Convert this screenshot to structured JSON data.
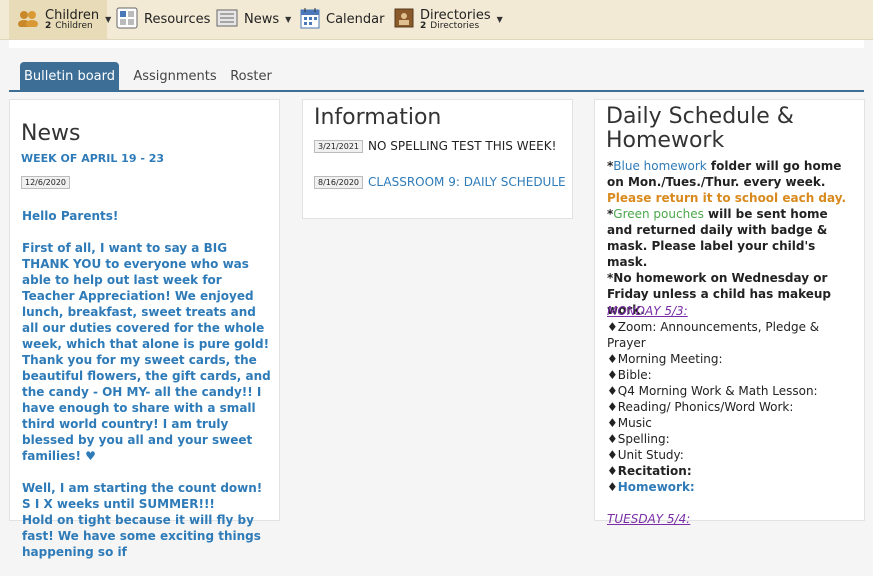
{
  "topnav": {
    "children_label": "Children",
    "children_count": "2",
    "children_sub": "Children",
    "resources": "Resources",
    "news": "News",
    "calendar": "Calendar",
    "directories_label": "Directories",
    "directories_count": "2",
    "directories_sub": "Directories"
  },
  "tabs": [
    "Bulletin board",
    "Assignments",
    "Roster"
  ],
  "news_card": {
    "title": "News",
    "week": "WEEK OF APRIL 19 - 23",
    "date": "12/6/2020",
    "greeting": "Hello Parents!",
    "p1": "First of all, I want to say a BIG THANK YOU  to everyone who was able to help out last week for Teacher Appreciation!  We enjoyed lunch, breakfast, sweet treats and all our duties covered for the whole week, which that alone is pure gold! Thank you for my sweet cards, the beautiful flowers, the gift cards, and the candy - OH MY- all the candy!! I have enough to share with a small third world country!  I am truly blessed by you all and your sweet families! ♥",
    "p2": "Well, I am starting the count down!  S I X weeks until SUMMER!!!",
    "p3": "Hold on tight because it will fly by fast!  We have some exciting things happening so if"
  },
  "info_card": {
    "title": "Information",
    "item1_date": "3/21/2021",
    "item1_text": "NO SPELLING TEST THIS WEEK!",
    "item2_date": "8/16/2020",
    "item2_text": "CLASSROOM 9: DAILY SCHEDULE"
  },
  "schedule_card": {
    "title_line1": "Daily Schedule &",
    "title_line2": "Homework",
    "blue_prefix": "*",
    "blue_hw": "Blue homework",
    "blue_rest": " folder will go home on Mon./Tues./Thur. every week.",
    "orange_text": "  Please return it to school each day.",
    "green_prefix": "*",
    "green_text": "Green pouches",
    "green_rest": " will be sent home and returned daily with badge & mask. Please label your child's mask.",
    "no_hw": "*No homework on Wednesday or Friday unless a child has makeup work.",
    "monday": "MONDAY 5/3: ",
    "items": [
      "♦Zoom: Announcements, Pledge & Prayer",
      "♦Morning Meeting:",
      "♦Bible:",
      "♦Q4 Morning Work & Math Lesson:",
      "♦Reading/ Phonics/Word Work:",
      "♦Music",
      "♦Spelling:",
      "♦Unit Study:"
    ],
    "recitation": "♦Recitation:",
    "homework_prefix": "♦",
    "homework": "Homework:",
    "tuesday": "TUESDAY 5/4:"
  }
}
